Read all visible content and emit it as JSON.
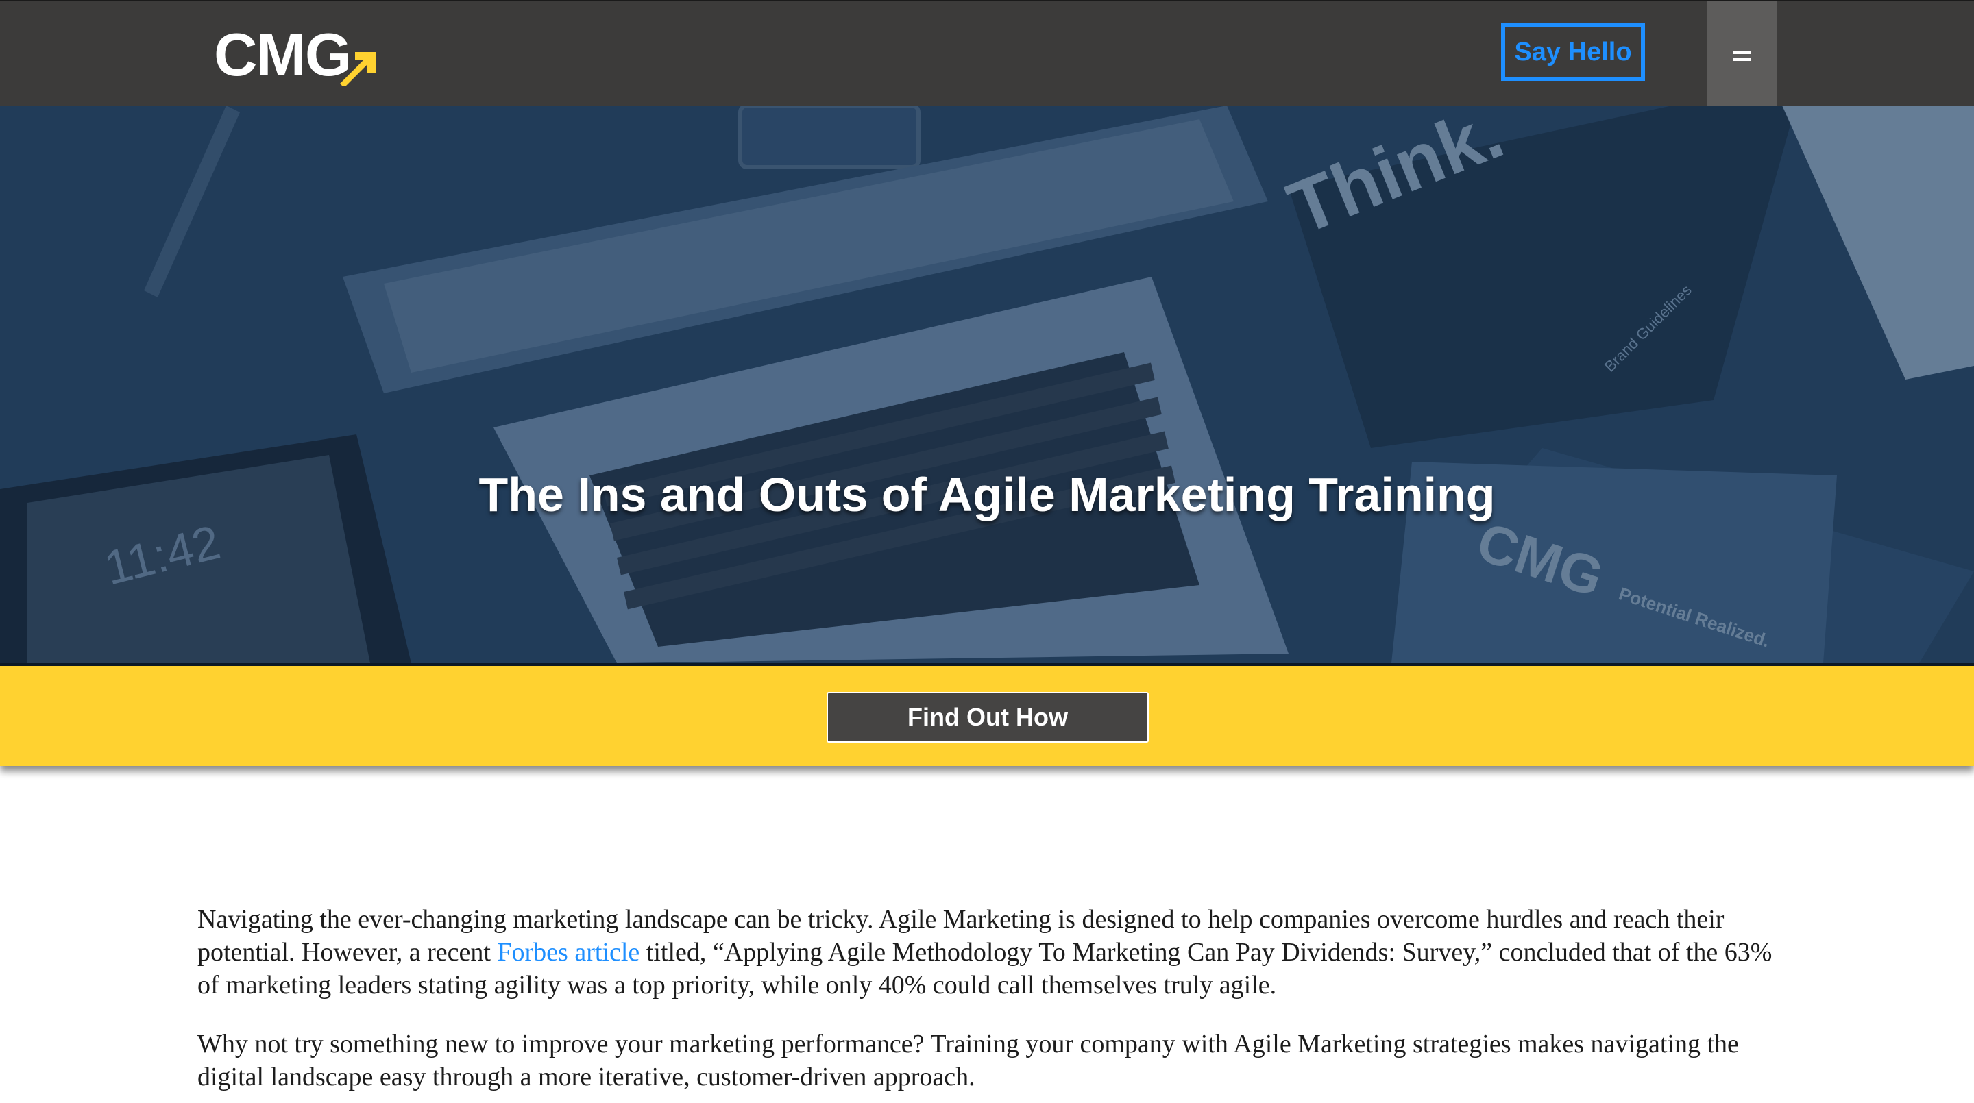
{
  "header": {
    "logo_text": "CMG",
    "say_hello_label": "Say Hello",
    "menu_icon": "hamburger-icon"
  },
  "hero": {
    "title": "The Ins and Outs of Agile Marketing Training",
    "photo_text": {
      "notebook_word": "Think.",
      "brand_guidelines": "Brand Guidelines",
      "tablet_time": "11:42",
      "cmg_logo": "CMG",
      "tagline": "Potential Realized."
    }
  },
  "cta": {
    "button_label": "Find Out How"
  },
  "article": {
    "p1_before_link": "Navigating the ever-changing marketing landscape can be tricky. Agile Marketing is designed to help companies overcome hurdles and reach their potential. However, a recent ",
    "p1_link": "Forbes article",
    "p1_after_link": " titled, “Applying Agile Methodology To Marketing Can Pay Dividends: Survey,” concluded that of the 63% of marketing leaders stating agility was a top priority, while only 40% could call themselves truly agile.",
    "p2": "Why not try something new to improve your marketing performance? Training your company with Agile Marketing strategies makes navigating the digital landscape easy through a more iterative, customer-driven approach."
  },
  "colors": {
    "header_bg": "#3c3b3a",
    "accent_blue": "#1e8fff",
    "accent_yellow": "#ffd230",
    "hero_overlay": "#1f3b5c",
    "button_bg": "#454443"
  }
}
